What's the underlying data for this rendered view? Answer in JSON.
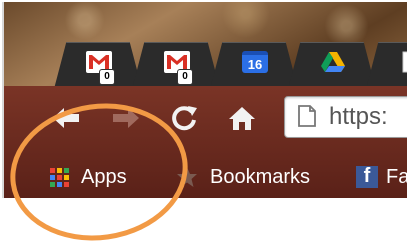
{
  "tabs": [
    {
      "name": "gmail",
      "badge": "0"
    },
    {
      "name": "gmail",
      "badge": "0"
    },
    {
      "name": "calendar",
      "day": "16"
    },
    {
      "name": "drive"
    },
    {
      "name": "new-tab"
    }
  ],
  "omnibox": {
    "text": "https:"
  },
  "bookmarks_bar": {
    "apps_label": "Apps",
    "bookmarks_label": "Bookmarks",
    "facebook_label": "Fa"
  },
  "colors": {
    "highlight": "#f29a45",
    "toolbar": "#7a3426",
    "tab": "#2b2b2b",
    "facebook": "#3b5998",
    "calendar": "#2b6fe6"
  }
}
